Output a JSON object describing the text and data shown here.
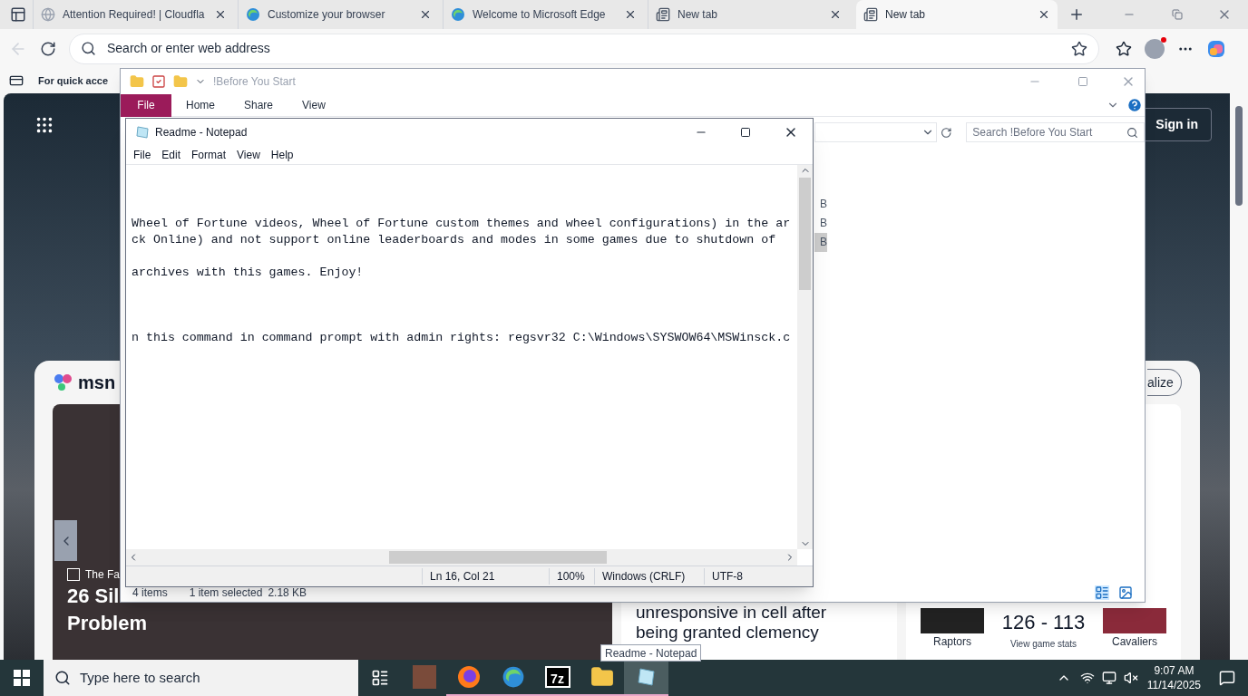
{
  "browser": {
    "tabs": [
      {
        "title": "Attention Required! | Cloudfla",
        "kind": "globe",
        "selected": false
      },
      {
        "title": "Customize your browser",
        "kind": "edge",
        "selected": false
      },
      {
        "title": "Welcome to Microsoft Edge",
        "kind": "edge",
        "selected": false
      },
      {
        "title": "New tab",
        "kind": "page",
        "selected": false
      },
      {
        "title": "New tab",
        "kind": "page",
        "selected": true
      }
    ],
    "address_bar": {
      "placeholder": "Search or enter web address"
    },
    "favorites_bar": {
      "text": "For quick acce"
    },
    "page": {
      "sign_in": "Sign in",
      "msn_logo": "msn",
      "personalize": "alize",
      "hero": {
        "source": "The Fa",
        "headline_lines": [
          "26 Sil",
          "Problem"
        ]
      },
      "story": {
        "headline_lines": [
          "unresponsive in cell after",
          "being granted clemency"
        ]
      },
      "score": {
        "home": "Raptors",
        "score": "126 - 113",
        "link": "View game stats",
        "away": "Cavaliers"
      }
    }
  },
  "explorer": {
    "title": "!Before You Start",
    "ribbon_tabs": [
      {
        "label": "File",
        "selected": true
      },
      {
        "label": "Home",
        "selected": false
      },
      {
        "label": "Share",
        "selected": false
      },
      {
        "label": "View",
        "selected": false
      }
    ],
    "search": {
      "placeholder": "Search !Before You Start"
    },
    "size_cells": [
      {
        "text": "B",
        "selected": false
      },
      {
        "text": "B",
        "selected": false
      },
      {
        "text": "B",
        "selected": true
      }
    ],
    "status": [
      "4 items",
      "1 item selected",
      "2.18 KB"
    ]
  },
  "notepad": {
    "title": "Readme - Notepad",
    "menu": [
      "File",
      "Edit",
      "Format",
      "View",
      "Help"
    ],
    "lines": [
      {
        "kind": "blank"
      },
      {
        "kind": "blank"
      },
      {
        "kind": "blank"
      },
      {
        "kind": "text",
        "text": "Wheel of Fortune videos, Wheel of Fortune custom themes and wheel configurations) in the ar"
      },
      {
        "kind": "text",
        "text": "ck Online) and not support online leaderboards and modes in some games due to shutdown of"
      },
      {
        "kind": "blank"
      },
      {
        "kind": "text",
        "text": "archives with this games. Enjoy!"
      },
      {
        "kind": "blank"
      },
      {
        "kind": "blank"
      },
      {
        "kind": "blank"
      },
      {
        "kind": "text",
        "text": "n this command in command prompt with admin rights: regsvr32 C:\\Windows\\SYSWOW64\\MSWinsck.c"
      }
    ],
    "status": [
      "Ln 16, Col 21",
      "100%",
      "Windows (CRLF)",
      "UTF-8"
    ]
  },
  "tooltip": "Readme - Notepad",
  "taskbar": {
    "search_placeholder": "Type here to search",
    "apps": [
      {
        "kind": "photo",
        "running": false,
        "selected": false
      },
      {
        "kind": "firefox",
        "running": true,
        "selected": false
      },
      {
        "kind": "edge",
        "running": true,
        "selected": false
      },
      {
        "kind": "archiver",
        "label": "7z",
        "running": true,
        "selected": false
      },
      {
        "kind": "folder",
        "running": true,
        "selected": false
      },
      {
        "kind": "notepad",
        "running": true,
        "selected": true
      }
    ],
    "time": "9:07 AM",
    "date": "11/14/2025"
  }
}
